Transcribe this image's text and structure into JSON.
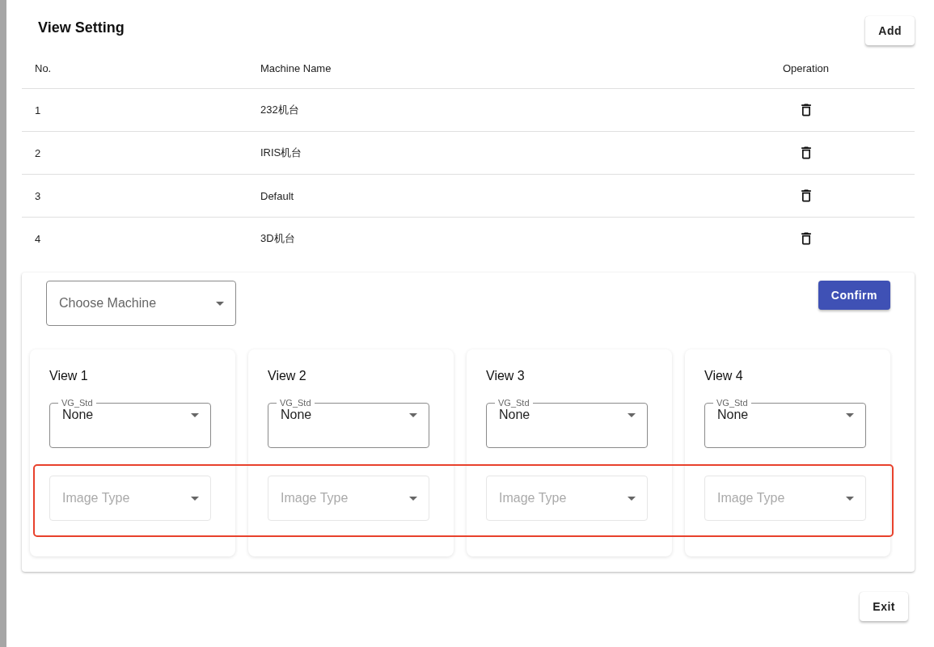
{
  "dialog": {
    "title": "View Setting",
    "add_button": "Add",
    "exit_button": "Exit"
  },
  "table": {
    "columns": [
      "No.",
      "Machine Name",
      "Operation"
    ],
    "rows": [
      {
        "no": "1",
        "name": "232机台"
      },
      {
        "no": "2",
        "name": "IRIS机台"
      },
      {
        "no": "3",
        "name": "Default"
      },
      {
        "no": "4",
        "name": "3D机台"
      }
    ]
  },
  "machine_select": {
    "placeholder": "Choose Machine"
  },
  "confirm_button": "Confirm",
  "views": [
    {
      "title": "View 1",
      "std_select": {
        "label": "VG_Std",
        "value": "None"
      },
      "image_type": {
        "placeholder": "Image Type",
        "disabled": true
      }
    },
    {
      "title": "View 2",
      "std_select": {
        "label": "VG_Std",
        "value": "None"
      },
      "image_type": {
        "placeholder": "Image Type",
        "disabled": true
      }
    },
    {
      "title": "View 3",
      "std_select": {
        "label": "VG_Std",
        "value": "None"
      },
      "image_type": {
        "placeholder": "Image Type",
        "disabled": true
      }
    },
    {
      "title": "View 4",
      "std_select": {
        "label": "VG_Std",
        "value": "None"
      },
      "image_type": {
        "placeholder": "Image Type",
        "disabled": true
      }
    }
  ],
  "annotation": {
    "kind": "rectangle",
    "color": "#e8412c"
  }
}
